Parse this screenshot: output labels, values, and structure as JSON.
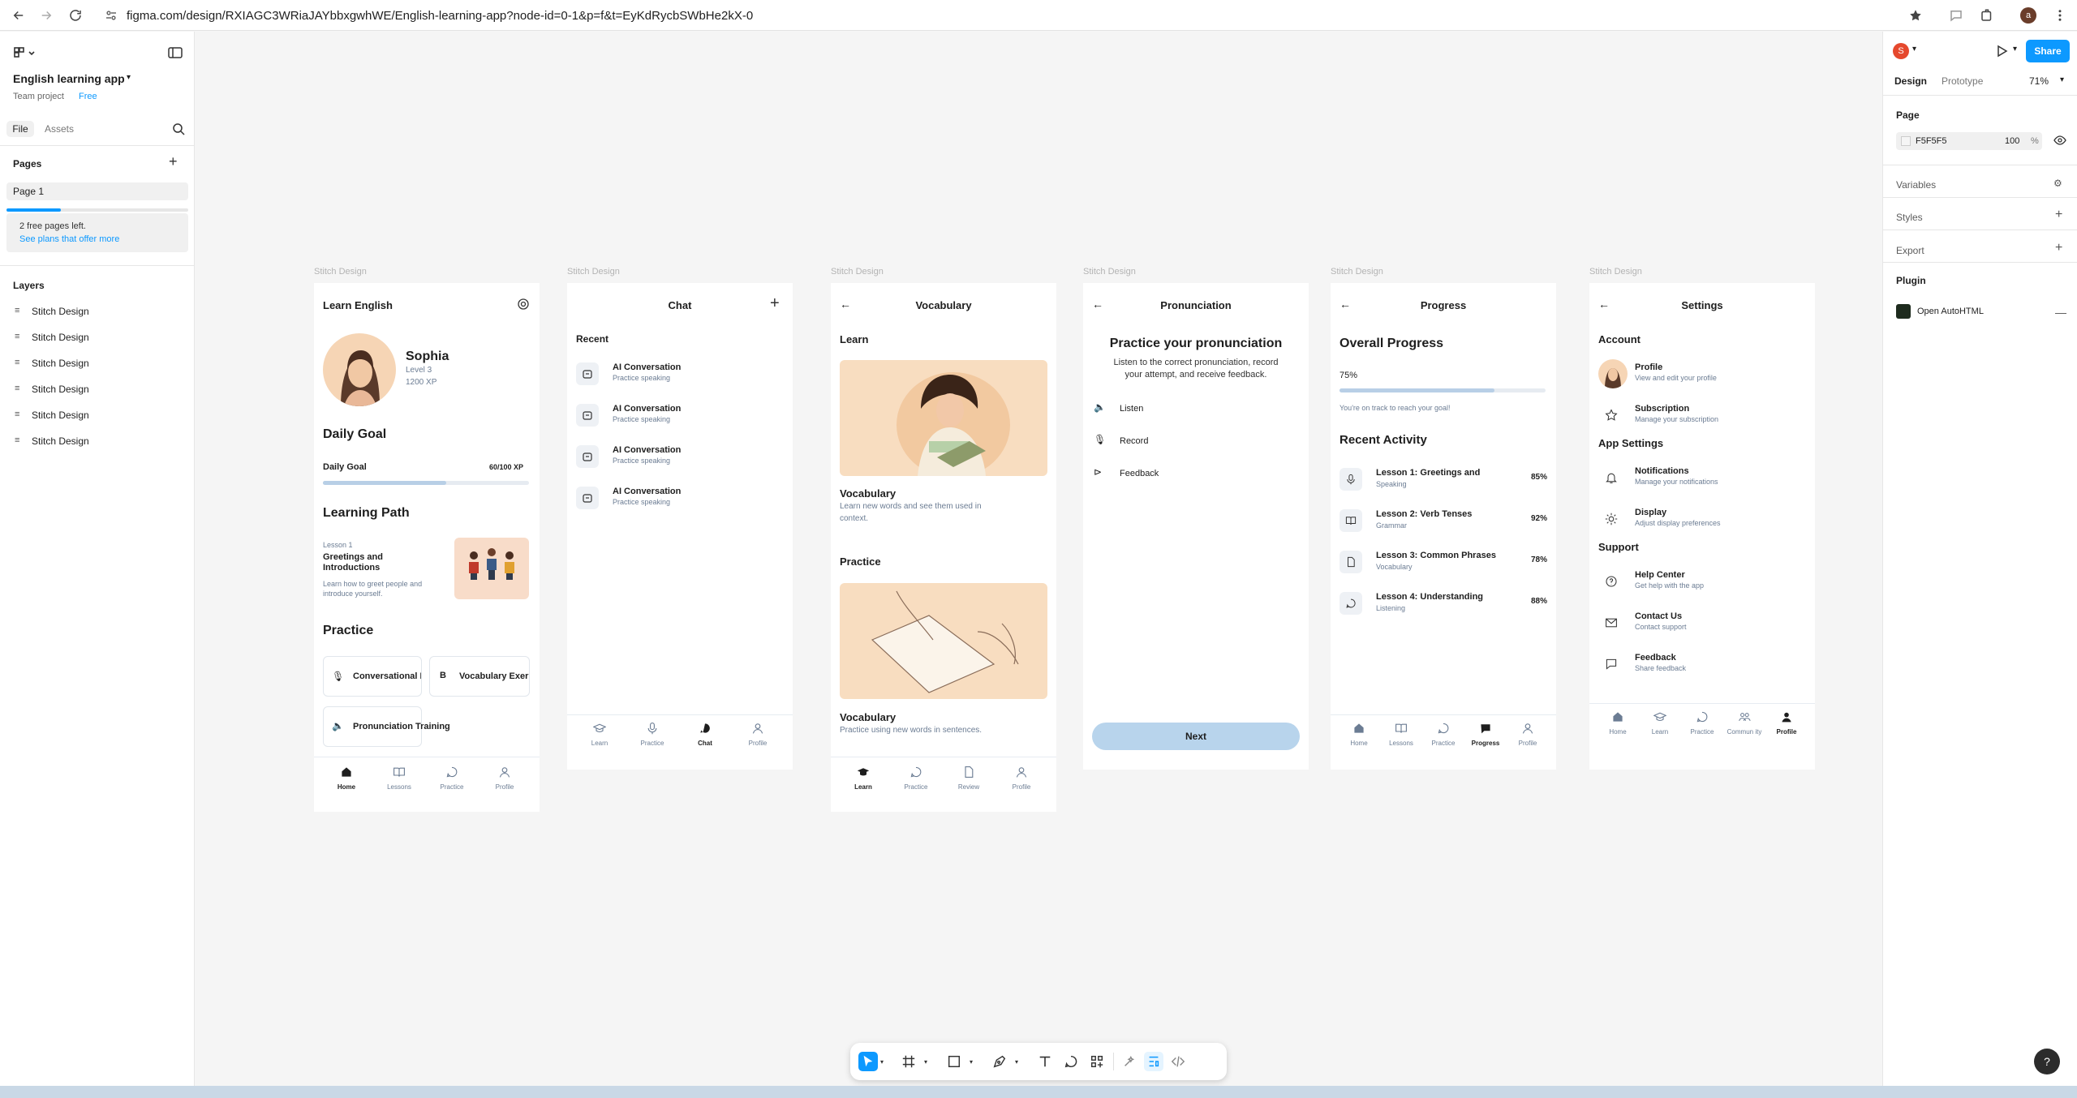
{
  "browser": {
    "url": "figma.com/design/RXIAGC3WRiaJAYbbxgwhWE/English-learning-app?node-id=0-1&p=f&t=EyKdRycbSWbHe2kX-0",
    "profile_initial": "a"
  },
  "left_panel": {
    "file_name": "English learning app",
    "team": "Team project",
    "plan": "Free",
    "tabs": [
      "File",
      "Assets"
    ],
    "pages_label": "Pages",
    "current_page": "Page 1",
    "pages_progress": 0.3,
    "free_pages_text": "2 free pages left.",
    "plans_link": "See plans that offer more",
    "layers_label": "Layers",
    "layers": [
      "Stitch Design",
      "Stitch Design",
      "Stitch Design",
      "Stitch Design",
      "Stitch Design",
      "Stitch Design"
    ]
  },
  "frame_label": "Stitch Design",
  "screens": {
    "home": {
      "title": "Learn English",
      "user_name": "Sophia",
      "level": "Level 3",
      "xp": "1200 XP",
      "daily_goal_heading": "Daily Goal",
      "daily_goal_label": "Daily Goal",
      "daily_goal_value": "60/100 XP",
      "daily_goal_progress": 0.6,
      "learning_path_heading": "Learning Path",
      "lesson_num": "Lesson 1",
      "lesson_title_1": "Greetings and",
      "lesson_title_2": "Introductions",
      "lesson_desc_1": "Learn how to greet people and",
      "lesson_desc_2": "introduce yourself.",
      "practice_heading": "Practice",
      "practice_items": [
        "Conversational I",
        "Vocabulary Exer",
        "Pronunciation Training"
      ],
      "nav": [
        "Home",
        "Lessons",
        "Practice",
        "Profile"
      ]
    },
    "chat": {
      "title": "Chat",
      "recent_label": "Recent",
      "items": [
        {
          "title": "AI Conversation",
          "sub": "Practice speaking"
        },
        {
          "title": "AI Conversation",
          "sub": "Practice speaking"
        },
        {
          "title": "AI Conversation",
          "sub": "Practice speaking"
        },
        {
          "title": "AI Conversation",
          "sub": "Practice speaking"
        }
      ],
      "nav": [
        "Learn",
        "Practice",
        "Chat",
        "Profile"
      ]
    },
    "vocabulary": {
      "title": "Vocabulary",
      "learn_heading": "Learn",
      "card1_title": "Vocabulary",
      "card1_desc_1": "Learn new words and see them used in",
      "card1_desc_2": "context.",
      "practice_heading": "Practice",
      "card2_title": "Vocabulary",
      "card2_desc": "Practice using new words in sentences.",
      "nav": [
        "Learn",
        "Practice",
        "Review",
        "Profile"
      ]
    },
    "pronunciation": {
      "title": "Pronunciation",
      "heading": "Practice your pronunciation",
      "desc_1": "Listen to the correct pronunciation, record",
      "desc_2": "your attempt, and receive feedback.",
      "items": [
        "Listen",
        "Record",
        "Feedback"
      ],
      "button": "Next"
    },
    "progress": {
      "title": "Progress",
      "overall_heading": "Overall Progress",
      "percent_label": "75%",
      "overall_progress": 0.75,
      "track_text": "You're on track to reach your goal!",
      "recent_heading": "Recent Activity",
      "activities": [
        {
          "title": "Lesson 1: Greetings and",
          "sub": "Speaking",
          "pct": "85%"
        },
        {
          "title": "Lesson 2: Verb Tenses",
          "sub": "Grammar",
          "pct": "92%"
        },
        {
          "title": "Lesson 3: Common Phrases",
          "sub": "Vocabulary",
          "pct": "78%"
        },
        {
          "title": "Lesson 4: Understanding",
          "sub": "Listening",
          "pct": "88%"
        }
      ],
      "nav": [
        "Home",
        "Lessons",
        "Practice",
        "Progress",
        "Profile"
      ]
    },
    "settings": {
      "title": "Settings",
      "account_heading": "Account",
      "account_items": [
        {
          "title": "Profile",
          "sub": "View and edit your profile"
        },
        {
          "title": "Subscription",
          "sub": "Manage your subscription"
        }
      ],
      "app_heading": "App Settings",
      "app_items": [
        {
          "title": "Notifications",
          "sub": "Manage your notifications"
        },
        {
          "title": "Display",
          "sub": "Adjust display preferences"
        }
      ],
      "support_heading": "Support",
      "support_items": [
        {
          "title": "Help Center",
          "sub": "Get help with the app"
        },
        {
          "title": "Contact Us",
          "sub": "Contact support"
        },
        {
          "title": "Feedback",
          "sub": "Share feedback"
        }
      ],
      "nav": [
        "Home",
        "Learn",
        "Practice",
        "Commun ity",
        "Profile"
      ]
    }
  },
  "right_panel": {
    "avatar_initial": "S",
    "share": "Share",
    "tabs": [
      "Design",
      "Prototype"
    ],
    "zoom": "71%",
    "page_label": "Page",
    "page_color": "F5F5F5",
    "page_opacity": "100",
    "percent": "%",
    "sections": [
      "Variables",
      "Styles",
      "Export"
    ],
    "plugin_label": "Plugin",
    "plugin_name": "Open AutoHTML"
  },
  "colors": {
    "accent": "#0d99ff",
    "canvas": "#f5f5f5",
    "progress": "#b8cfe6",
    "next_button": "#b8d4ec"
  }
}
